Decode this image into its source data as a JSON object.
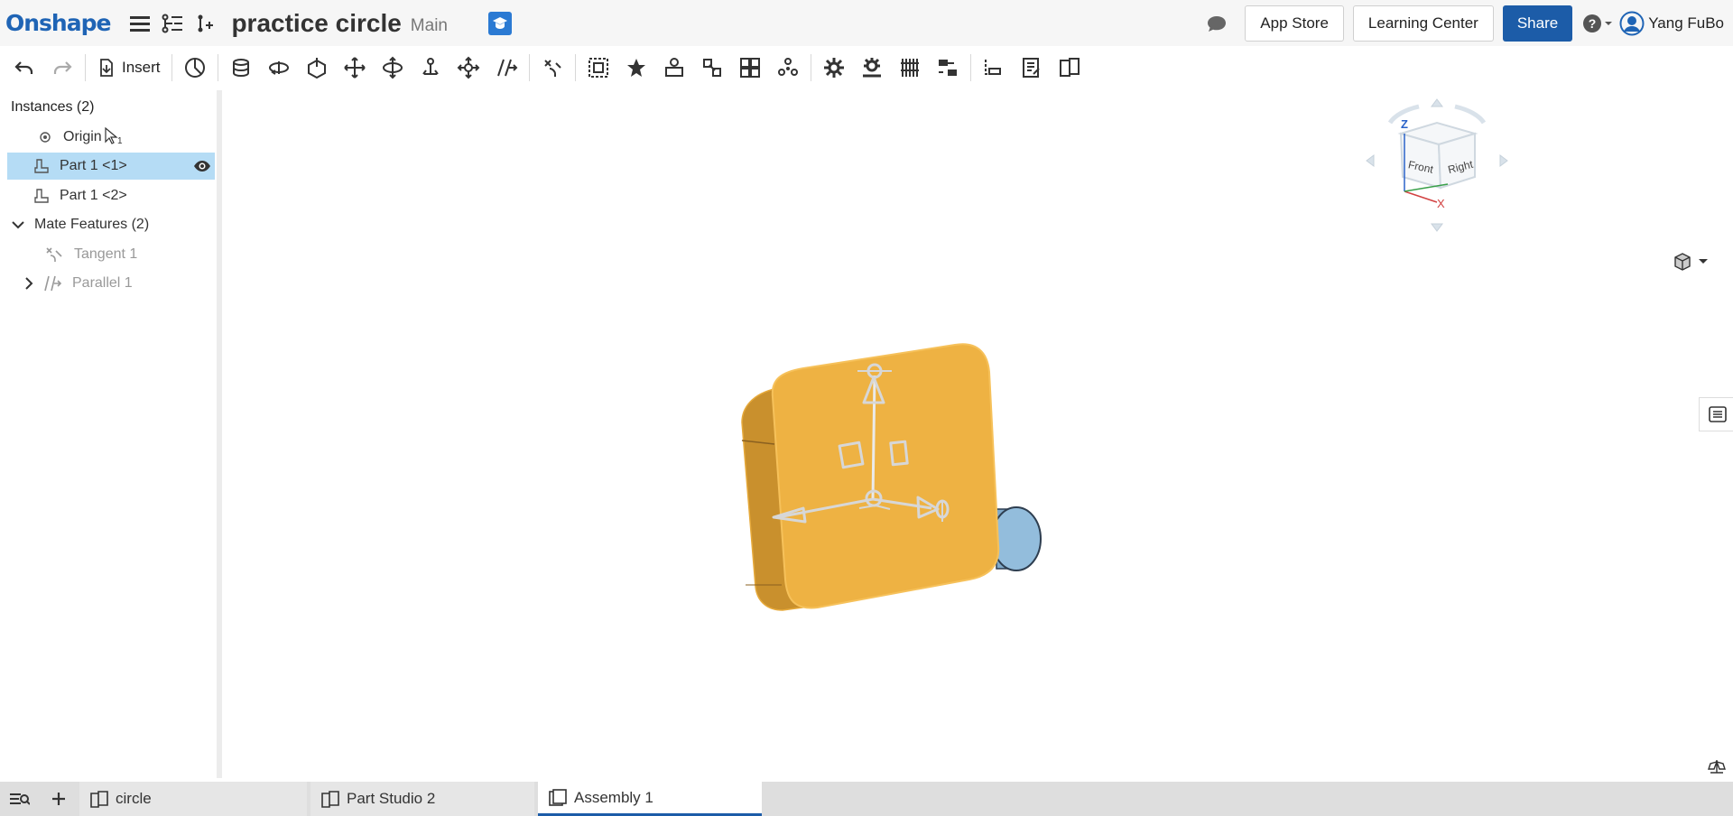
{
  "header": {
    "logo": "Onshape",
    "doc_title": "practice circle",
    "branch": "Main",
    "app_store": "App Store",
    "learning_center": "Learning Center",
    "share": "Share",
    "user_name": "Yang FuBo"
  },
  "toolbar": {
    "insert_label": "Insert"
  },
  "tree": {
    "instances_header": "Instances (2)",
    "origin": "Origin",
    "cursor_label": "1",
    "part1": "Part 1 <1>",
    "part2": "Part 1 <2>",
    "mate_features": "Mate Features (2)",
    "tangent": "Tangent 1",
    "parallel": "Parallel 1"
  },
  "view_cube": {
    "z_label": "Z",
    "x_label": "X",
    "front": "Front",
    "right": "Right"
  },
  "tabs": {
    "items": [
      "circle",
      "Part Studio 2",
      "Assembly 1"
    ],
    "active": "Assembly 1"
  },
  "colors": {
    "brand": "#1f64b5",
    "share_button": "#1c5ca8",
    "part_orange": "#f0b040",
    "cylinder_blue": "#8fb8d8",
    "selection": "#b5dcf5"
  }
}
